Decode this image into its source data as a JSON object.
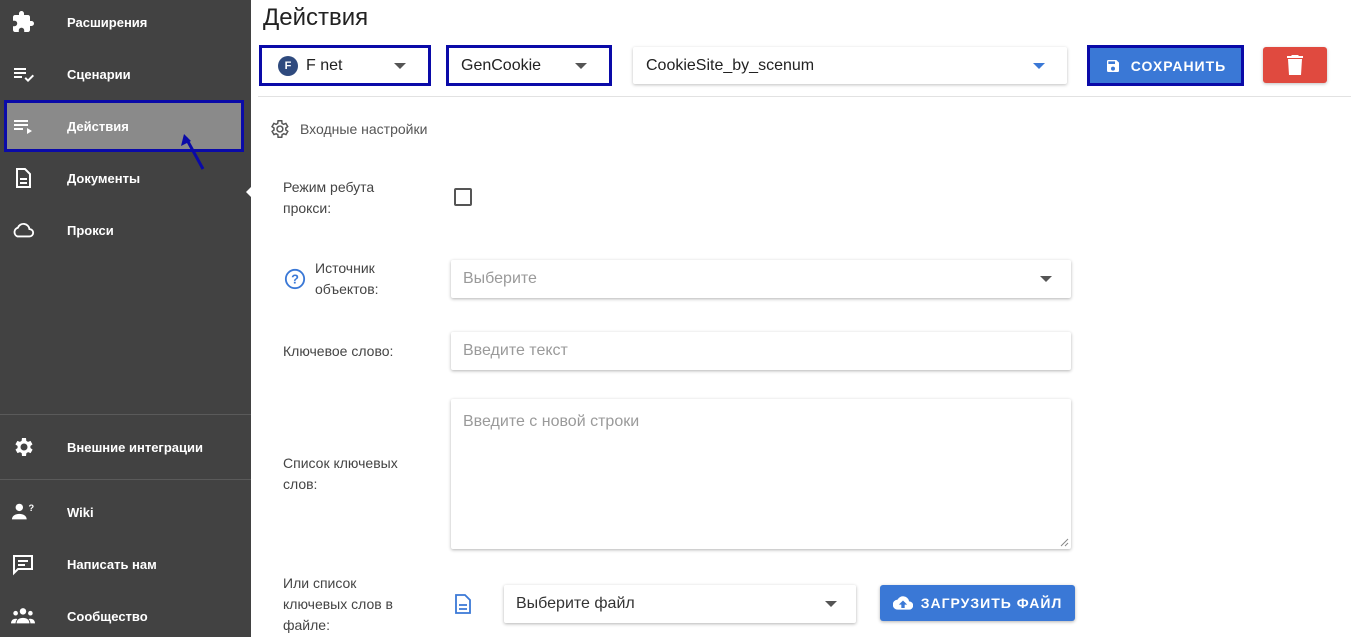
{
  "sidebar": {
    "items": [
      {
        "label": "Расширения",
        "icon": "puzzle-icon"
      },
      {
        "label": "Сценарии",
        "icon": "playlist-check-icon"
      },
      {
        "label": "Действия",
        "icon": "playlist-play-icon",
        "active": true
      },
      {
        "label": "Документы",
        "icon": "document-icon"
      },
      {
        "label": "Прокси",
        "icon": "cloud-icon"
      }
    ],
    "bottom_items": [
      {
        "label": "Внешние интеграции",
        "icon": "gear-icon"
      },
      {
        "label": "Wiki",
        "icon": "user-question-icon"
      },
      {
        "label": "Написать нам",
        "icon": "message-icon"
      },
      {
        "label": "Сообщество",
        "icon": "people-icon"
      }
    ]
  },
  "header": {
    "title": "Действия",
    "account_select": {
      "avatar_letter": "F",
      "value": "F net"
    },
    "action_select": {
      "value": "GenCookie"
    },
    "scenario_select": {
      "value": "CookieSite_by_scenum"
    },
    "save_label": "СОХРАНИТЬ"
  },
  "form": {
    "section_title": "Входные настройки",
    "reboot_proxy_label": "Режим ребута прокси:",
    "reboot_proxy_checked": false,
    "object_source_label": "Источник объектов:",
    "object_source_placeholder": "Выберите",
    "keyword_label": "Ключевое слово:",
    "keyword_placeholder": "Введите текст",
    "keyword_list_label": "Список ключевых слов:",
    "keyword_list_placeholder": "Введите с новой строки",
    "file_label": "Или список ключевых слов в файле:",
    "file_select_value": "Выберите файл",
    "upload_label": "ЗАГРУЗИТЬ ФАЙЛ"
  },
  "colors": {
    "sidebar_bg": "#424242",
    "active_bg": "#8a8a8a",
    "highlight": "#0a0aa8",
    "primary": "#3a78d6",
    "danger": "#e04a3f"
  }
}
